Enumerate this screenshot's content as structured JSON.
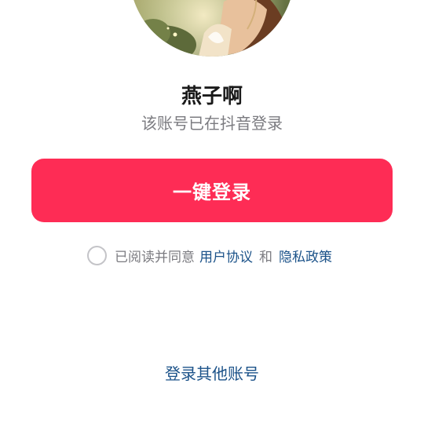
{
  "account": {
    "username": "燕子啊",
    "status_text": "该账号已在抖音登录"
  },
  "login_button": {
    "label": "一键登录",
    "color": "#fe2c55"
  },
  "agreement": {
    "checked": false,
    "prefix_text": "已阅读并同意",
    "user_agreement_link": "用户协议",
    "conjunction": "和",
    "privacy_policy_link": "隐私政策",
    "link_color": "#1b5289"
  },
  "other_login": {
    "label": "登录其他账号"
  },
  "icons": {
    "avatar": "user-avatar-image"
  }
}
